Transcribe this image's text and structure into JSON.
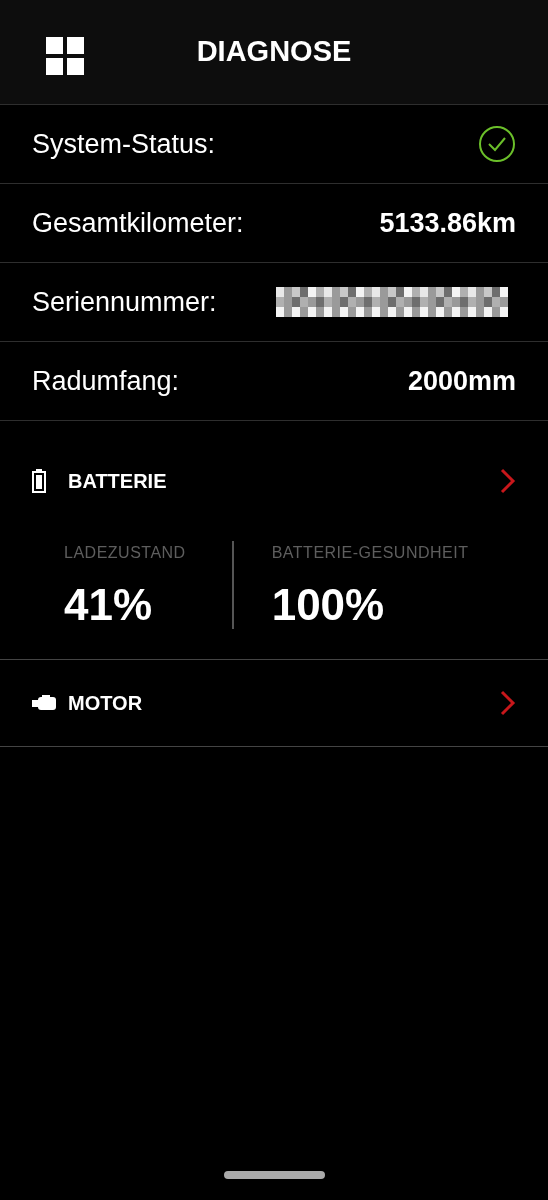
{
  "header": {
    "title": "DIAGNOSE"
  },
  "info_rows": [
    {
      "kind": "status",
      "label": "System-Status:",
      "ok": true
    },
    {
      "kind": "value",
      "label": "Gesamtkilometer:",
      "value": "5133.86km"
    },
    {
      "kind": "redacted",
      "label": "Seriennummer:"
    },
    {
      "kind": "value",
      "label": "Radumfang:",
      "value": "2000mm"
    }
  ],
  "sections": [
    {
      "kind": "battery",
      "title": "BATTERIE",
      "stats": [
        {
          "label": "LADEZUSTAND",
          "value": "41%"
        },
        {
          "label": "BATTERIE-GESUNDHEIT",
          "value": "100%"
        }
      ]
    },
    {
      "kind": "motor",
      "title": "MOTOR"
    }
  ]
}
